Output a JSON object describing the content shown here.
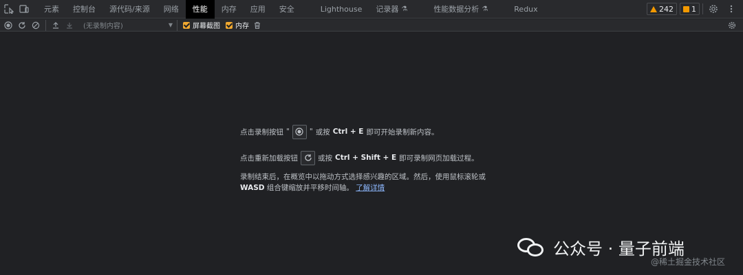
{
  "tabs": [
    {
      "label": "元素"
    },
    {
      "label": "控制台"
    },
    {
      "label": "源代码/来源"
    },
    {
      "label": "网络"
    },
    {
      "label": "性能",
      "active": true
    },
    {
      "label": "内存"
    },
    {
      "label": "应用"
    },
    {
      "label": "安全"
    },
    {
      "label": "Lighthouse"
    },
    {
      "label": "记录器"
    },
    {
      "label": "性能数据分析"
    },
    {
      "label": "Redux"
    }
  ],
  "badges": {
    "warnings": "242",
    "issues": "1"
  },
  "toolbar": {
    "recording_select": "(无录制内容)",
    "screenshots_label": "屏幕截图",
    "memory_label": "内存"
  },
  "landing": {
    "line1_before": "点击录制按钮",
    "line1_q1": "\"",
    "line1_q2": "\"",
    "line1_mid": "或按",
    "line1_keys": "Ctrl + E",
    "line1_after": "即可开始录制新内容。",
    "line2_before": "点击重新加载按钮",
    "line2_mid": "或按",
    "line2_keys": "Ctrl + Shift + E",
    "line2_after": "即可录制网页加载过程。",
    "para_text1": "录制结束后，在概览中以拖动方式选择感兴趣的区域。然后，使用鼠标滚轮或",
    "para_keys": "WASD",
    "para_text2": "组合键缩放并平移时间轴。",
    "learn_more": "了解详情"
  },
  "watermark": {
    "title": "公众号 · 量子前端",
    "sub": "@稀土掘金技术社区"
  },
  "colors": {
    "active_tab_bg": "#000000",
    "checkbox": "#f0a830",
    "link": "#8ab4f8",
    "warning": "#f29900"
  }
}
